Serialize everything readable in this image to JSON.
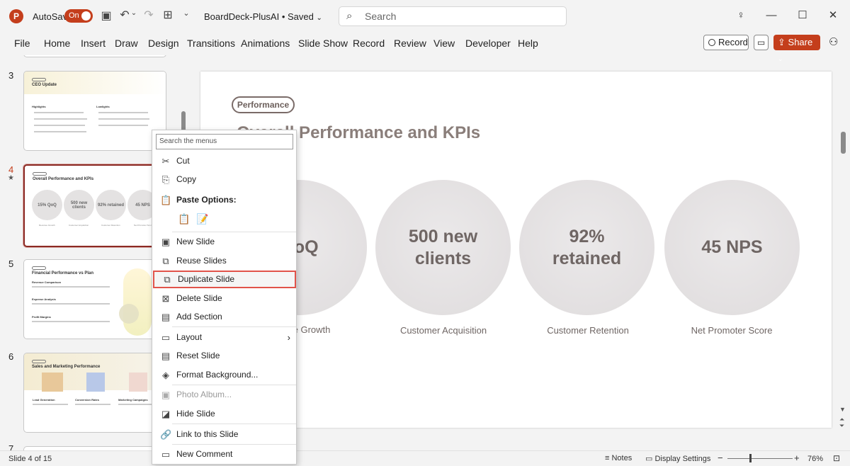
{
  "app": {
    "autosave_label": "AutoSave",
    "autosave_state": "On",
    "doc_title": "BoardDeck-PlusAI • Saved",
    "logo_letter": "P"
  },
  "search": {
    "placeholder": "Search"
  },
  "ribbon": {
    "tabs": [
      "File",
      "Home",
      "Insert",
      "Draw",
      "Design",
      "Transitions",
      "Animations",
      "Slide Show",
      "Record",
      "Review",
      "View",
      "Developer",
      "Help"
    ],
    "record_label": "Record",
    "share_label": "Share"
  },
  "thumbnails": [
    {
      "num": "3",
      "title": "CEO Update",
      "col1": "Highlights",
      "col2": "Lowlights"
    },
    {
      "num": "4",
      "title": "Overall Performance and KPIs",
      "kpis": [
        "15% QoQ",
        "500 new clients",
        "92% retained",
        "45 NPS"
      ],
      "kpi_labels": [
        "Revenue Growth",
        "Customer Acquisition",
        "Customer Retention",
        "Net Promoter Score"
      ]
    },
    {
      "num": "5",
      "title": "Financial Performance vs Plan",
      "sections": [
        "Revenue Comparison",
        "Expense Analysis",
        "Profit Margins"
      ]
    },
    {
      "num": "6",
      "title": "Sales and Marketing Performance",
      "cols": [
        "Lead Generation",
        "Conversion Rates",
        "Marketing Campaigns"
      ]
    },
    {
      "num": "7"
    }
  ],
  "slide": {
    "tag": "Performance",
    "title": "Overall Performance and KPIs",
    "kpis": [
      {
        "value": "QoQ",
        "label": "e Growth"
      },
      {
        "value": "500 new clients",
        "label": "Customer Acquisition"
      },
      {
        "value": "92% retained",
        "label": "Customer Retention"
      },
      {
        "value": "45 NPS",
        "label": "Net Promoter Score"
      }
    ]
  },
  "context_menu": {
    "search_placeholder": "Search the menus",
    "items": {
      "cut": "Cut",
      "copy": "Copy",
      "paste_options": "Paste Options:",
      "new_slide": "New Slide",
      "reuse_slides": "Reuse Slides",
      "duplicate_slide": "Duplicate Slide",
      "delete_slide": "Delete Slide",
      "add_section": "Add Section",
      "layout": "Layout",
      "reset_slide": "Reset Slide",
      "format_background": "Format Background...",
      "photo_album": "Photo Album...",
      "hide_slide": "Hide Slide",
      "link_to_slide": "Link to this Slide",
      "new_comment": "New Comment"
    },
    "highlighted_item": "Duplicate Slide"
  },
  "status": {
    "slide_info": "Slide 4 of 15",
    "notes": "Notes",
    "display_settings": "Display Settings",
    "zoom": "76%"
  },
  "colors": {
    "accent": "#c43e1c",
    "selection_border": "#8c2a24",
    "highlight": "#e1534a"
  }
}
